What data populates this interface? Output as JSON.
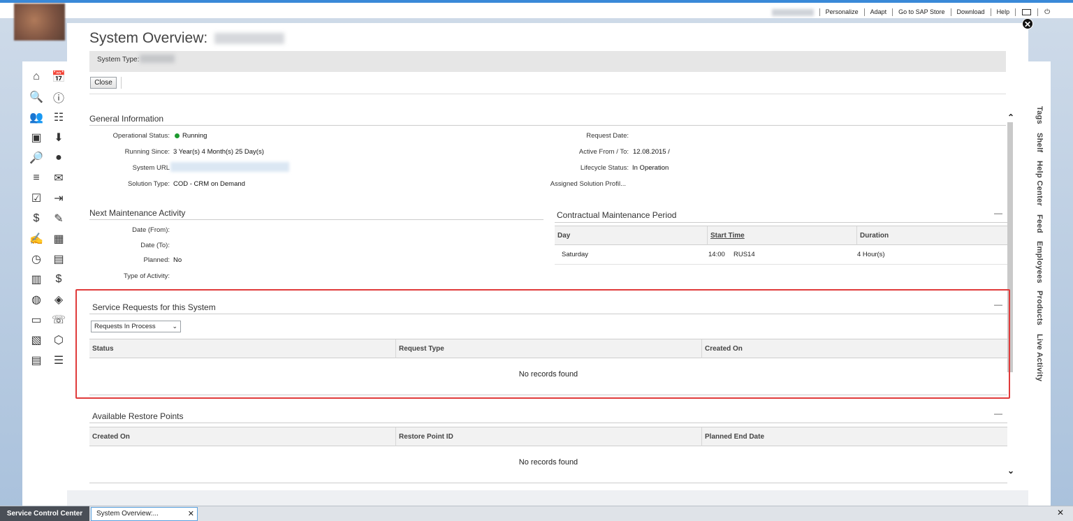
{
  "header": {
    "links": [
      "Personalize",
      "Adapt",
      "Go to SAP Store",
      "Download",
      "Help"
    ],
    "icons": [
      "monitor-icon",
      "power-icon"
    ]
  },
  "left_nav": {
    "icons": [
      "home-icon",
      "calendar-14-icon",
      "search-icon",
      "alert-icon",
      "org-people-icon",
      "hierarchy-icon",
      "product-box-icon",
      "download-icon",
      "inspect-icon",
      "person-icon",
      "contact-list-icon",
      "mail-icon",
      "checklist-icon",
      "money-transfer-icon",
      "dollar-icon",
      "person-edit-icon",
      "edit-doc-icon",
      "calendar-clock-icon",
      "timesheet-icon",
      "invoice-icon",
      "document-icon",
      "money-doc-icon",
      "globe-icon",
      "map-icon",
      "calendar-icon",
      "phone-list-icon",
      "clipboard-icon",
      "cube-icon",
      "doc-list-icon",
      "list-icon"
    ],
    "glyphs": [
      "⌂",
      "📅",
      "🔍",
      "ⓘ",
      "👥",
      "☷",
      "▣",
      "⬇",
      "🔎",
      "●",
      "≡",
      "✉",
      "☑",
      "⇥",
      "$",
      "✎",
      "✍",
      "▦",
      "◷",
      "▤",
      "▥",
      "$",
      "◍",
      "◈",
      "▭",
      "☏",
      "▧",
      "⬡",
      "▤",
      "☰"
    ]
  },
  "right_tabs": [
    "Tags",
    "Shelf",
    "Help Center",
    "Feed",
    "Employees",
    "Products",
    "Live Activity"
  ],
  "page": {
    "title": "System Overview:",
    "system_type_label": "System Type:",
    "close_button": "Close"
  },
  "general_info": {
    "title": "General Information",
    "left_fields": [
      {
        "label": "Operational Status:",
        "value": "Running"
      },
      {
        "label": "Running Since:",
        "value": "3 Year(s) 4 Month(s) 25 Day(s)"
      },
      {
        "label": "System URL",
        "value": ""
      },
      {
        "label": "Solution Type:",
        "value": "COD - CRM on Demand"
      }
    ],
    "right_fields": [
      {
        "label": "Request Date:",
        "value": ""
      },
      {
        "label": "Active From / To:",
        "value": "12.08.2015 /"
      },
      {
        "label": "Lifecycle Status:",
        "value": "In Operation"
      },
      {
        "label": "Assigned Solution Profil...",
        "value": ""
      }
    ],
    "status_color": "#1d9a2f"
  },
  "next_maintenance": {
    "title": "Next Maintenance Activity",
    "fields": [
      {
        "label": "Date (From):",
        "value": ""
      },
      {
        "label": "Date (To):",
        "value": ""
      },
      {
        "label": "Planned:",
        "value": "No"
      },
      {
        "label": "Type of Activity:",
        "value": ""
      }
    ]
  },
  "contractual": {
    "title": "Contractual Maintenance Period",
    "columns": [
      "Day",
      "Start Time",
      "Duration"
    ],
    "rows": [
      {
        "day": "Saturday",
        "start": "14:00",
        "zone": "RUS14",
        "duration": "4 Hour(s)"
      }
    ]
  },
  "service_requests": {
    "title": "Service Requests for this System",
    "filter_value": "Requests In Process",
    "columns": [
      "Status",
      "Request Type",
      "Created On"
    ],
    "empty_text": "No records found"
  },
  "restore_points": {
    "title": "Available Restore Points",
    "columns": [
      "Created On",
      "Restore Point ID",
      "Planned End Date"
    ],
    "empty_text": "No records found"
  },
  "taskbar": {
    "active": "Service Control Center",
    "tab": "System Overview:..."
  }
}
